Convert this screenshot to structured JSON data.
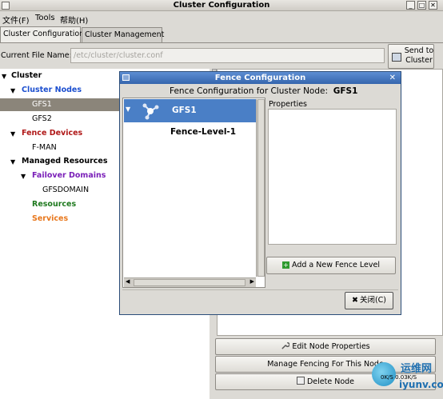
{
  "window": {
    "title": "Cluster Configuration"
  },
  "window_buttons": [
    "_",
    "□",
    "✕"
  ],
  "menu": {
    "file": "文件(F)",
    "tools": "Tools",
    "help": "帮助(H)"
  },
  "tabs": [
    {
      "label": "Cluster Configuration",
      "active": true
    },
    {
      "label": "Cluster Management",
      "active": false
    }
  ],
  "file_row": {
    "label": "Current File Name:",
    "value": "/etc/cluster/cluster.conf"
  },
  "send_button": {
    "line1": "Send to",
    "line2": "Cluster"
  },
  "tree": {
    "cluster": "Cluster",
    "cluster_nodes": "Cluster Nodes",
    "nodes": [
      "GFS1",
      "GFS2"
    ],
    "fence_devices": "Fence Devices",
    "fence_items": [
      "F-MAN"
    ],
    "managed_resources": "Managed Resources",
    "failover_domains": "Failover Domains",
    "failover_items": [
      "GFSDOMAIN"
    ],
    "resources": "Resources",
    "services": "Services",
    "colors": {
      "cluster_nodes": "#1c4fcf",
      "fence_devices": "#b01818",
      "failover_domains": "#7a1fb8",
      "resources": "#1f7a1f",
      "services": "#e8771c"
    }
  },
  "right_buttons": {
    "edit": "Edit Node Properties",
    "manage": "Manage Fencing For This Node",
    "delete": "Delete Node"
  },
  "dialog": {
    "title": "Fence Configuration",
    "header_prefix": "Fence Configuration for Cluster Node:",
    "header_node": "GFS1",
    "selected_node": "GFS1",
    "fence_level": "Fence-Level-1",
    "properties_label": "Properties",
    "add_button": "Add a New Fence Level",
    "close_button": "关闭(C)"
  },
  "watermark": {
    "cn": "运维网",
    "en": "iyunv.com",
    "speed": "0K/S  0.03K/S"
  }
}
